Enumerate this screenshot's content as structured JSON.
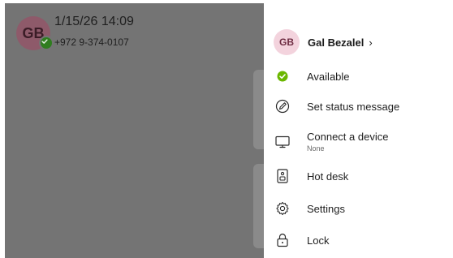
{
  "background": {
    "contact": {
      "avatar_initials": "GB",
      "timestamp": "1/15/26 14:09",
      "phone": "+972 9-374-0107"
    }
  },
  "drawer": {
    "profile": {
      "initials": "GB",
      "name": "Gal Bezalel",
      "chevron": "›"
    },
    "items": [
      {
        "label": "Available",
        "icon": "available-status-icon"
      },
      {
        "label": "Set status message",
        "icon": "status-message-icon"
      },
      {
        "label": "Connect a device",
        "sublabel": "None",
        "icon": "monitor-icon"
      },
      {
        "label": "Hot desk",
        "icon": "hot-desk-icon"
      },
      {
        "label": "Settings",
        "icon": "gear-icon"
      },
      {
        "label": "Lock",
        "icon": "lock-icon"
      }
    ]
  },
  "colors": {
    "available_green": "#6bb700",
    "avatar_bg": "#f3d3dd",
    "scrim": "#747474"
  }
}
